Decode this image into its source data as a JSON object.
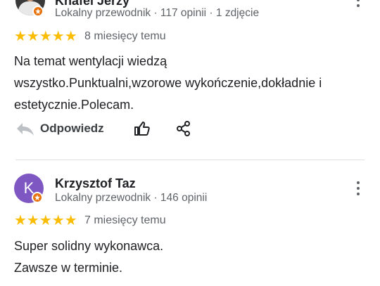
{
  "review1": {
    "author": "Knafel Jerzy",
    "meta": "Lokalny przewodnik · 117 opinii · 1 zdjęcie",
    "stars": "★★★★★",
    "time": "8 miesięcy temu",
    "text_line1": "Na temat wentylacji wiedzą",
    "text_line2": "wszystko.Punktualni,wzorowe wykończenie,dokładnie i",
    "text_line3": "estetycznie.Polecam.",
    "reply_label": "Odpowiedz"
  },
  "review2": {
    "avatar_letter": "K",
    "author": "Krzysztof Taz",
    "meta": "Lokalny przewodnik · 146 opinii",
    "stars": "★★★★★",
    "time": "7 miesięcy temu",
    "text_line1": "Super solidny wykonawca.",
    "text_line2": "Zawsze w terminie."
  },
  "colors": {
    "star": "#fbbc04",
    "badge": "#e8710a",
    "avatar_bg": "#7e57c2"
  }
}
